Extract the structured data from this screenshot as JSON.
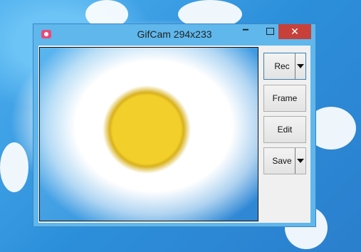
{
  "window": {
    "title": "GifCam 294x233",
    "controls": {
      "minimize": "−",
      "close": "✕"
    }
  },
  "buttons": {
    "rec": "Rec",
    "frame": "Frame",
    "edit": "Edit",
    "save": "Save"
  },
  "colors": {
    "close_button": "#c7413a",
    "window_frame": "#5fb7ec",
    "app_icon": "#e84a7a"
  },
  "icons": [
    "camera-icon",
    "chevron-down-icon"
  ]
}
